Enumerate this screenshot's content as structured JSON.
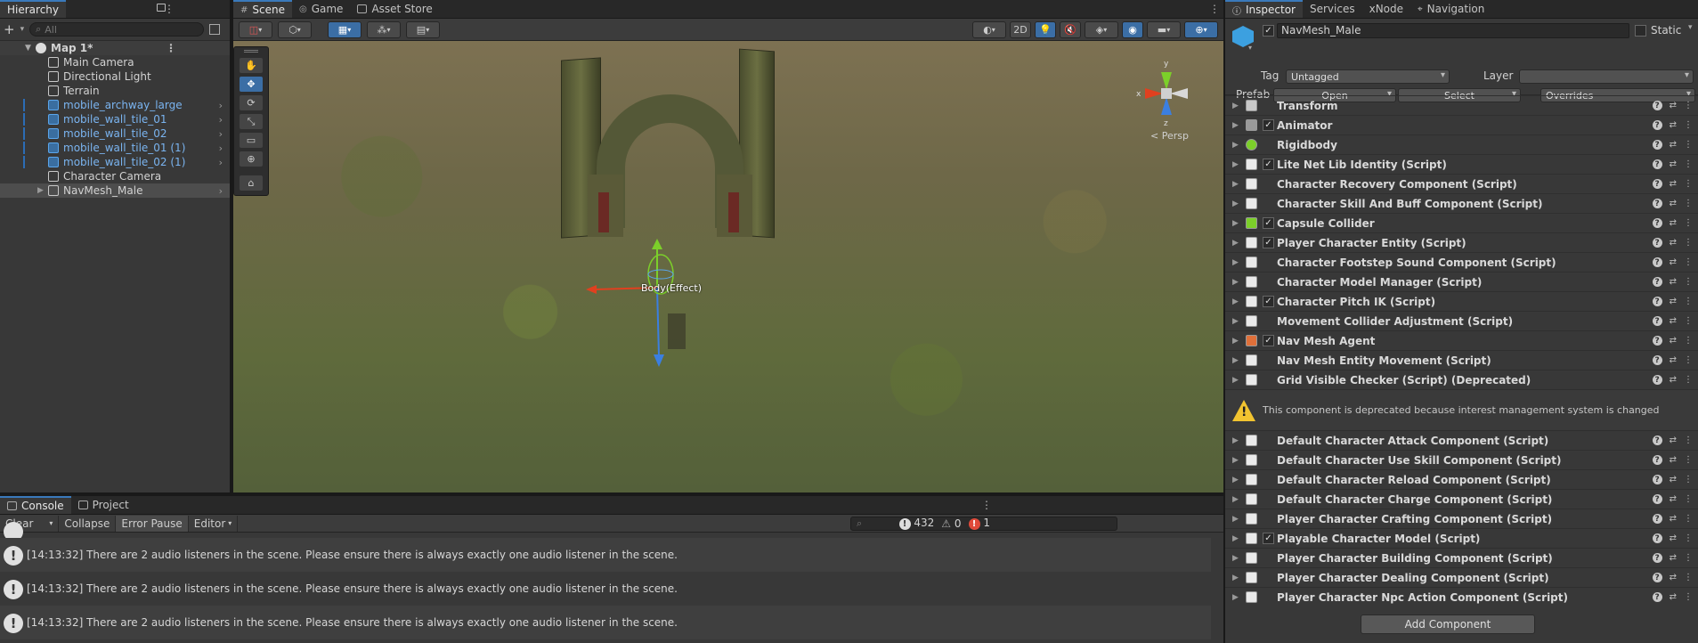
{
  "hierarchy": {
    "tab_label": "Hierarchy",
    "search_placeholder": "All",
    "scene_name": "Map 1*",
    "items": [
      {
        "label": "Main Camera",
        "prefab": false,
        "expandable": false
      },
      {
        "label": "Directional Light",
        "prefab": false,
        "expandable": false
      },
      {
        "label": "Terrain",
        "prefab": false,
        "expandable": false
      },
      {
        "label": "mobile_archway_large",
        "prefab": true,
        "expandable": true
      },
      {
        "label": "mobile_wall_tile_01",
        "prefab": true,
        "expandable": true
      },
      {
        "label": "mobile_wall_tile_02",
        "prefab": true,
        "expandable": true
      },
      {
        "label": "mobile_wall_tile_01 (1)",
        "prefab": true,
        "expandable": true
      },
      {
        "label": "mobile_wall_tile_02 (1)",
        "prefab": true,
        "expandable": true
      },
      {
        "label": "Character Camera",
        "prefab": false,
        "expandable": false
      },
      {
        "label": "NavMesh_Male",
        "prefab": false,
        "expandable": true,
        "selected": true
      }
    ]
  },
  "scene": {
    "tabs": [
      "Scene",
      "Game",
      "Asset Store"
    ],
    "active_tab": "Scene",
    "toolbar": {
      "mode_2d": "2D"
    },
    "persp_label": "< Persp",
    "gizmo_axes": {
      "y": "y",
      "x": "x",
      "z": "z"
    },
    "object_label": "Body(Effect)"
  },
  "console": {
    "tabs": [
      "Console",
      "Project"
    ],
    "toolbar": {
      "clear": "Clear",
      "collapse": "Collapse",
      "error_pause": "Error Pause",
      "editor": "Editor"
    },
    "counts": {
      "warnings_log": "432",
      "warnings": "0",
      "errors": "1"
    },
    "messages": [
      "[14:13:32] There are 2 audio listeners in the scene. Please ensure there is always exactly one audio listener in the scene.",
      "[14:13:32] There are 2 audio listeners in the scene. Please ensure there is always exactly one audio listener in the scene.",
      "[14:13:32] There are 2 audio listeners in the scene. Please ensure there is always exactly one audio listener in the scene."
    ]
  },
  "inspector": {
    "tabs": [
      "Inspector",
      "Services",
      "xNode",
      "Navigation"
    ],
    "object_name": "NavMesh_Male",
    "static_label": "Static",
    "tag_label": "Tag",
    "tag_value": "Untagged",
    "layer_label": "Layer",
    "layer_value": "",
    "prefab_label": "Prefab",
    "prefab_open": "Open",
    "prefab_select": "Select",
    "prefab_overrides": "Overrides",
    "components": [
      {
        "name": "Transform",
        "checkbox": false,
        "icon": "transform-icon"
      },
      {
        "name": "Animator",
        "checkbox": true,
        "icon": "animator-icon"
      },
      {
        "name": "Rigidbody",
        "checkbox": false,
        "icon": "rigidbody-icon"
      },
      {
        "name": "Lite Net Lib Identity (Script)",
        "checkbox": true,
        "icon": "script-icon"
      },
      {
        "name": "Character Recovery Component (Script)",
        "checkbox": false,
        "icon": "script-icon"
      },
      {
        "name": "Character Skill And Buff Component (Script)",
        "checkbox": false,
        "icon": "script-icon"
      },
      {
        "name": "Capsule Collider",
        "checkbox": true,
        "icon": "capsule-icon"
      },
      {
        "name": "Player Character Entity (Script)",
        "checkbox": true,
        "icon": "script-icon"
      },
      {
        "name": "Character Footstep Sound Component (Script)",
        "checkbox": false,
        "icon": "script-icon"
      },
      {
        "name": "Character Model Manager (Script)",
        "checkbox": false,
        "icon": "script-icon"
      },
      {
        "name": "Character Pitch IK (Script)",
        "checkbox": true,
        "icon": "script-icon"
      },
      {
        "name": "Movement Collider Adjustment (Script)",
        "checkbox": false,
        "icon": "script-icon"
      },
      {
        "name": "Nav Mesh Agent",
        "checkbox": true,
        "icon": "navmesh-agent-icon"
      },
      {
        "name": "Nav Mesh Entity Movement (Script)",
        "checkbox": false,
        "icon": "script-icon"
      },
      {
        "name": "Grid Visible Checker (Script) (Deprecated)",
        "checkbox": false,
        "icon": "script-icon"
      }
    ],
    "deprecation_warning": "This component is deprecated because interest management system is changed",
    "components_after": [
      {
        "name": "Default Character Attack Component (Script)",
        "checkbox": false
      },
      {
        "name": "Default Character Use Skill Component (Script)",
        "checkbox": false
      },
      {
        "name": "Default Character Reload Component (Script)",
        "checkbox": false
      },
      {
        "name": "Default Character Charge Component (Script)",
        "checkbox": false
      },
      {
        "name": "Player Character Crafting Component (Script)",
        "checkbox": false
      },
      {
        "name": "Playable Character Model (Script)",
        "checkbox": true
      },
      {
        "name": "Player Character Building Component (Script)",
        "checkbox": false
      },
      {
        "name": "Player Character Dealing Component (Script)",
        "checkbox": false
      },
      {
        "name": "Player Character Npc Action Component (Script)",
        "checkbox": false
      }
    ],
    "add_component": "Add Component"
  }
}
